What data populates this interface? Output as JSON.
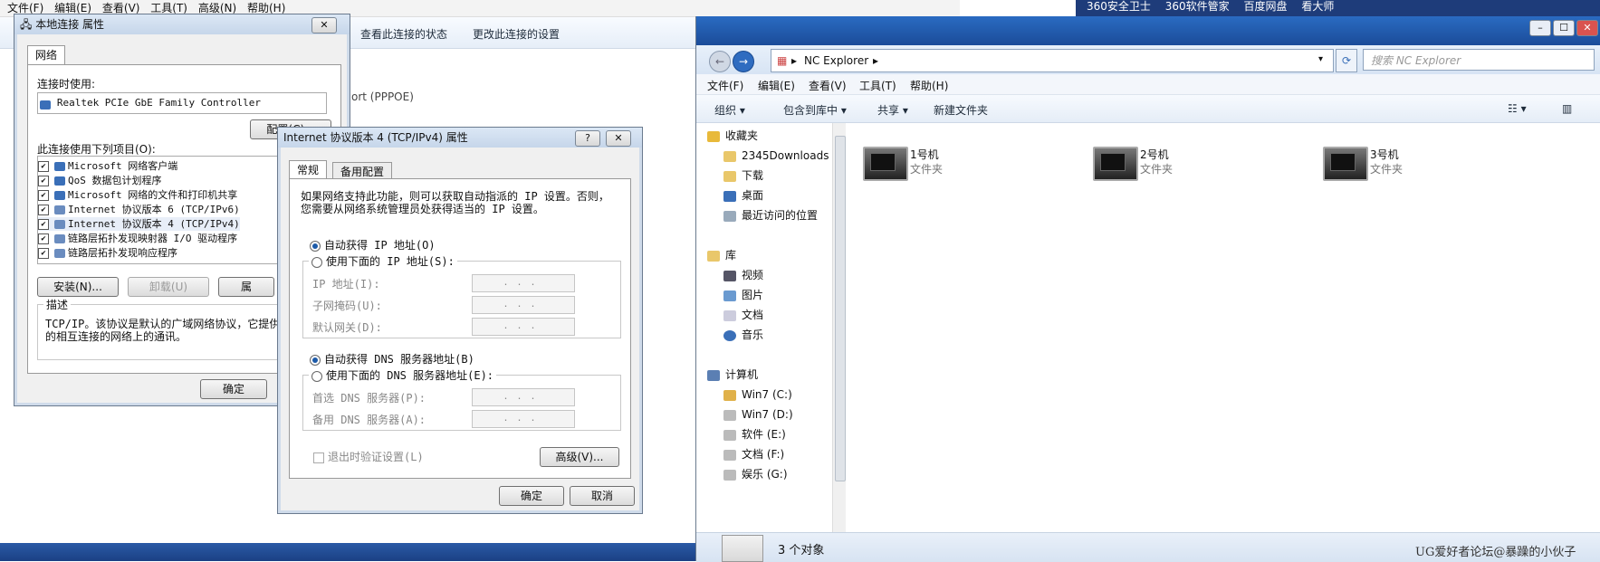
{
  "background": {
    "menu": [
      "文件(F)",
      "编辑(E)",
      "查看(V)",
      "工具(T)",
      "高级(N)",
      "帮助(H)"
    ],
    "toolbar": [
      "查看此连接的状态",
      "更改此连接的设置"
    ],
    "pppoe_text": "ort (PPPOE)",
    "taskbar_items": [
      "360安全卫士",
      "360软件管家",
      "百度网盘",
      "看大师"
    ]
  },
  "lan_dialog": {
    "title": "本地连接 属性",
    "tab": "网络",
    "connect_using_label": "连接时使用:",
    "adapter": "Realtek PCIe GbE Family Controller",
    "configure_btn": "配置(C)...",
    "items_label": "此连接使用下列项目(O):",
    "items": [
      "Microsoft 网络客户端",
      "QoS 数据包计划程序",
      "Microsoft 网络的文件和打印机共享",
      "Internet 协议版本 6 (TCP/IPv6)",
      "Internet 协议版本 4 (TCP/IPv4)",
      "链路层拓扑发现映射器 I/O 驱动程序",
      "链路层拓扑发现响应程序"
    ],
    "install_btn": "安装(N)...",
    "uninstall_btn": "卸载(U)",
    "properties_btn": "属",
    "desc_title": "描述",
    "desc_text_1": "TCP/IP。该协议是默认的广域网络协议，它提供",
    "desc_text_2": "的相互连接的网络上的通讯。",
    "ok_btn": "确定"
  },
  "ipv4_dialog": {
    "title": "Internet 协议版本 4 (TCP/IPv4) 属性",
    "help_icon": "?",
    "tabs": [
      "常规",
      "备用配置"
    ],
    "intro_1": "如果网络支持此功能，则可以获取自动指派的 IP 设置。否则，",
    "intro_2": "您需要从网络系统管理员处获得适当的 IP 设置。",
    "auto_ip": "自动获得 IP 地址(O)",
    "manual_ip": "使用下面的 IP 地址(S):",
    "ip_label": "IP 地址(I):",
    "mask_label": "子网掩码(U):",
    "gateway_label": "默认网关(D):",
    "auto_dns": "自动获得 DNS 服务器地址(B)",
    "manual_dns": "使用下面的 DNS 服务器地址(E):",
    "dns1_label": "首选 DNS 服务器(P):",
    "dns2_label": "备用 DNS 服务器(A):",
    "ip_dots": "...",
    "validate": "退出时验证设置(L)",
    "advanced_btn": "高级(V)...",
    "ok_btn": "确定",
    "cancel_btn": "取消"
  },
  "explorer": {
    "address": "NC Explorer",
    "search_placeholder": "搜索 NC Explorer",
    "menu": [
      "文件(F)",
      "编辑(E)",
      "查看(V)",
      "工具(T)",
      "帮助(H)"
    ],
    "commands": [
      "组织 ▾",
      "包含到库中 ▾",
      "共享 ▾",
      "新建文件夹"
    ],
    "nav": {
      "favorites": "收藏夹",
      "fav_items": [
        "2345Downloads",
        "下载",
        "桌面",
        "最近访问的位置"
      ],
      "library": "库",
      "lib_items": [
        "视频",
        "图片",
        "文档",
        "音乐"
      ],
      "computer": "计算机",
      "drives": [
        "Win7 (C:)",
        "Win7 (D:)",
        "软件 (E:)",
        "文档 (F:)",
        "娱乐 (G:)"
      ]
    },
    "folders": [
      {
        "name": "1号机",
        "type": "文件夹"
      },
      {
        "name": "2号机",
        "type": "文件夹"
      },
      {
        "name": "3号机",
        "type": "文件夹"
      }
    ],
    "status": "3 个对象",
    "watermark": "UG爱好者论坛@暴躁的小伙子"
  }
}
